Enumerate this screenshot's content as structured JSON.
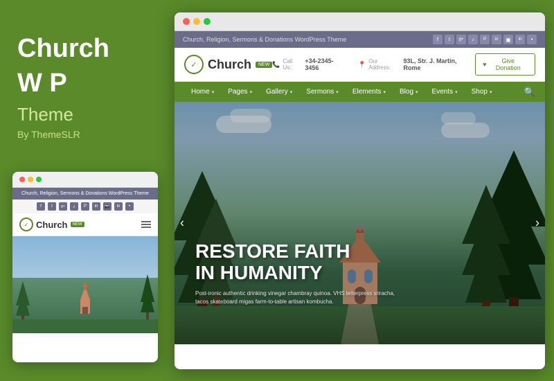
{
  "left": {
    "title_line1": "Church",
    "title_line2": "W P",
    "subtitle": "Theme",
    "author": "By ThemeSLR"
  },
  "browser": {
    "topbar_text": "Church, Religion, Sermons & Donations WordPress Theme",
    "logo_name": "Church",
    "logo_badge": "NEW",
    "contact_phone_label": "Call Us:",
    "contact_phone": "+34-2345-3456",
    "contact_address_label": "Our Address:",
    "contact_address": "93L, Str. J. Martin, Rome",
    "donate_btn": "Give Donation",
    "nav_items": [
      {
        "label": "Home",
        "has_arrow": true
      },
      {
        "label": "Pages",
        "has_arrow": true
      },
      {
        "label": "Gallery",
        "has_arrow": true
      },
      {
        "label": "Sermons",
        "has_arrow": true
      },
      {
        "label": "Elements",
        "has_arrow": true
      },
      {
        "label": "Blog",
        "has_arrow": true
      },
      {
        "label": "Events",
        "has_arrow": true
      },
      {
        "label": "Shop",
        "has_arrow": true
      }
    ],
    "hero_title_line1": "RESTORE FAITH",
    "hero_title_line2": "IN HUMANITY",
    "hero_subtitle": "Post-ironic authentic drinking vinegar chambray quinoa. VHS letterpress sriracha, tacos skateboard migas farm-to-table artisan kombucha."
  },
  "mobile": {
    "topbar_text": "Church, Religion, Sermons & Donations WordPress Theme",
    "logo_name": "Church",
    "logo_badge": "NEW"
  },
  "social_icons": [
    "f",
    "t",
    "g+",
    "♪",
    "in",
    "in",
    "cam",
    "in",
    "•••"
  ]
}
